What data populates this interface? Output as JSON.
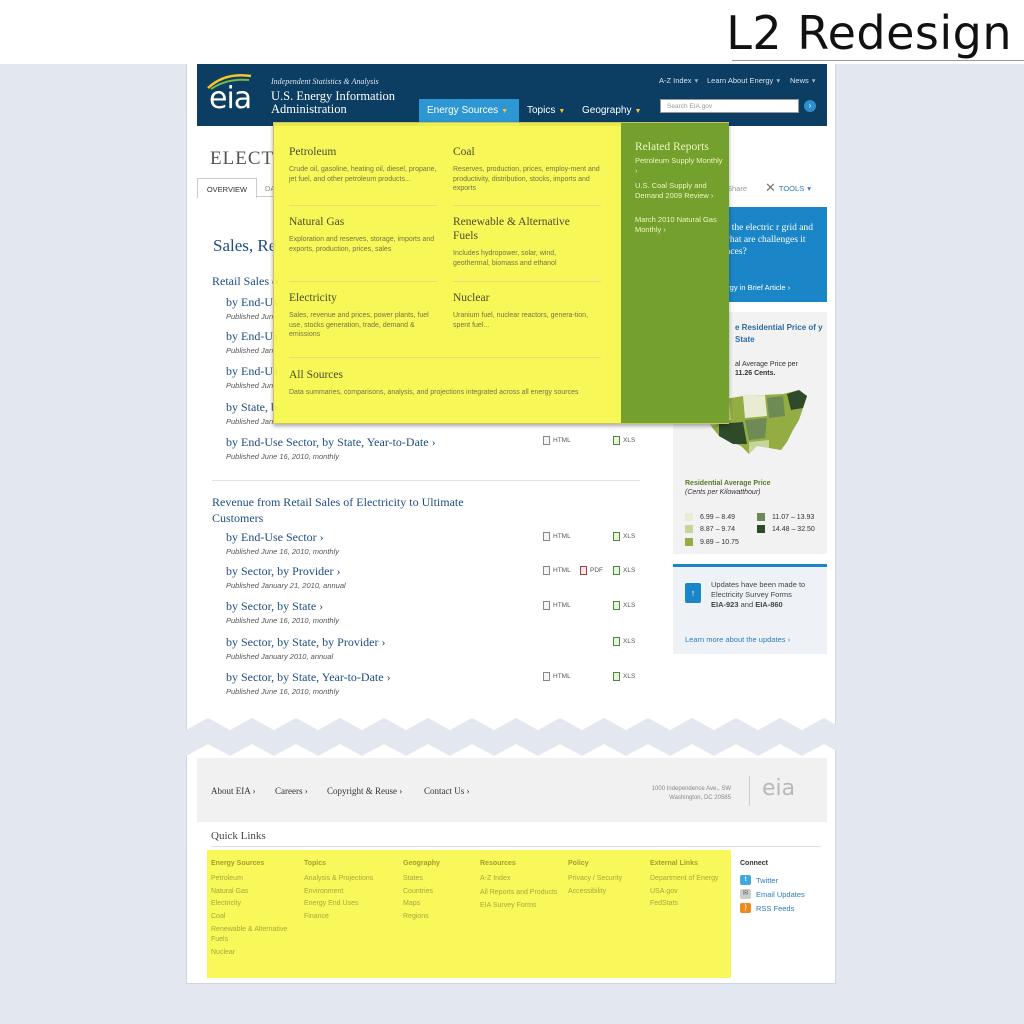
{
  "slide": {
    "title": "L2 Redesign"
  },
  "header": {
    "logo_text": "eia",
    "tagline": "Independent Statistics & Analysis",
    "org_line1": "U.S. Energy Information",
    "org_line2": "Administration",
    "util_links": [
      "A-Z Index",
      "Learn About Energy",
      "News"
    ],
    "search_placeholder": "Search EIA.gov",
    "tabs": [
      "Energy Sources",
      "Topics",
      "Geography"
    ]
  },
  "mega_menu": {
    "items": [
      {
        "title": "Petroleum",
        "desc": "Crude oil, gasoline, heating oil, diesel, propane, jet fuel, and other petroleum products..."
      },
      {
        "title": "Coal",
        "desc": "Reserves, production, prices, employ-ment and productivity, distribution, stocks, imports and exports"
      },
      {
        "title": "Natural Gas",
        "desc": "Exploration and reserves, storage, imports and exports, production, prices, sales"
      },
      {
        "title": "Renewable & Alternative Fuels",
        "desc": "Includes hydropower, solar, wind, geothermal, biomass and ethanol"
      },
      {
        "title": "Electricity",
        "desc": "Sales, revenue and prices, power plants, fuel use, stocks generation, trade, demand & emissions"
      },
      {
        "title": "Nuclear",
        "desc": "Uranium fuel, nuclear reactors, genera-tion, spent fuel..."
      },
      {
        "title": "All Sources",
        "desc": "Data summaries, comparisons, analysis, and projections integrated across all energy sources"
      }
    ],
    "related_title": "Related Reports",
    "related": [
      "Petroleum Supply Monthly ›",
      "U.S. Coal Supply and Demand 2009 Review ›",
      "March 2010 Natural Gas Monthly ›"
    ]
  },
  "content": {
    "page_title": "ELECT",
    "subnav": [
      "OVERVIEW",
      "DA"
    ],
    "section_title": "Sales, Re",
    "retail_heading": "Retail Sales o",
    "retail_rows": [
      {
        "link": "by End-Us",
        "pub": "Published Jun"
      },
      {
        "link": "by End-Us",
        "pub": "Published Jan"
      },
      {
        "link": "by End-Us",
        "pub": "Published Jun"
      },
      {
        "link": "by State, b",
        "pub": "Published Jan"
      },
      {
        "link": "by End-Use Sector, by State, Year-to-Date ›",
        "pub": "Published June 16, 2010, monthly"
      }
    ],
    "revenue_heading": "Revenue from Retail Sales of Electricity to Ultimate Customers",
    "revenue_rows": [
      {
        "link": "by End-Use Sector ›",
        "pub": "Published June 16, 2010, monthly"
      },
      {
        "link": "by Sector, by Provider ›",
        "pub": "Published January 21, 2010, annual"
      },
      {
        "link": "by Sector, by State ›",
        "pub": "Published June 16, 2010, monthly"
      },
      {
        "link": "by Sector, by State, by Provider ›",
        "pub": "Published January 2010, annual"
      },
      {
        "link": "by Sector, by State, Year-to-Date ›",
        "pub": "Published June 16, 2010, monthly"
      }
    ],
    "dl_labels": {
      "html": "HTML",
      "pdf": "PDF",
      "xls": "XLS"
    }
  },
  "sidebar": {
    "share": "Share",
    "tools": "TOOLS",
    "blue_question": "is the electric r grid and what are challenges it faces?",
    "blue_link": "ergy in Brief Article ›",
    "map_title": "e Residential Price of y State",
    "map_sub_1": "al Average Price per",
    "map_sub_2": "11.26 Cents.",
    "legend_title": "Residential Average Price",
    "legend_sub": "(Cents per Kilowatthour)",
    "legend": [
      {
        "label": "6.99 – 8.49",
        "color": "#e8ecd2"
      },
      {
        "label": "11.07 – 13.93",
        "color": "#6e8a55"
      },
      {
        "label": "8.87 – 9.74",
        "color": "#c7d59a"
      },
      {
        "label": "14.48 – 32.50",
        "color": "#2e4a2a"
      },
      {
        "label": "9.89 – 10.75",
        "color": "#93ad43"
      }
    ],
    "update_text_1": "Updates have been made to Electricity Survey Forms",
    "update_form_a": "EIA-923",
    "update_and": "and",
    "update_form_b": "EIA-860",
    "update_link": "Learn more about the updates ›"
  },
  "footer": {
    "links": [
      "About EIA ›",
      "Careers ›",
      "Copyright & Reuse ›",
      "Contact Us ›"
    ],
    "address_1": "1000 Independence Ave., SW",
    "address_2": "Washington, DC 20585",
    "logo": "eia",
    "quick_links_title": "Quick Links",
    "columns": [
      {
        "head": "Energy Sources",
        "items": [
          "Petroleum",
          "Natural Gas",
          "Electricity",
          "Coal",
          "Renewable & Alternative Fuels",
          "Nuclear"
        ]
      },
      {
        "head": "Topics",
        "items": [
          "Analysis & Projections",
          "Environment",
          "Energy End Uses",
          "Finance"
        ]
      },
      {
        "head": "Geography",
        "items": [
          "States",
          "Countries",
          "Maps",
          "Regions"
        ]
      },
      {
        "head": "Resources",
        "items": [
          "A-Z Index",
          "All Reports and Products",
          "EIA Survey Forms"
        ]
      },
      {
        "head": "Policy",
        "items": [
          "Privacy / Security",
          "Accessibility"
        ]
      },
      {
        "head": "External Links",
        "items": [
          "Department of Energy",
          "USA.gov",
          "FedStats"
        ]
      }
    ],
    "connect_head": "Connect",
    "connect": [
      "Twitter",
      "Email Updates",
      "RSS Feeds"
    ]
  }
}
